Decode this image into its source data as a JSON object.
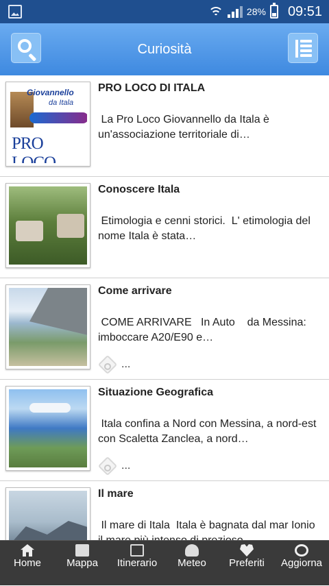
{
  "status_bar": {
    "battery": "28%",
    "time": "09:51"
  },
  "header": {
    "title": "Curiosità",
    "search_icon": "search-icon",
    "menu_icon": "list-menu-icon"
  },
  "items": [
    {
      "title": "PRO LOCO DI ITALA",
      "description": " La Pro Loco Giovannello da Itala è un'associazione territoriale di…",
      "has_more": false,
      "logo": {
        "line1": "Giovannello",
        "line2": "da Itala",
        "line3": "PRO LOCO"
      }
    },
    {
      "title": "Conoscere Itala",
      "description": " Etimologia e cenni storici.  L' etimologia del nome Itala è stata…",
      "has_more": false
    },
    {
      "title": "Come arrivare",
      "description": " COME ARRIVARE   In Auto    da Messina: imboccare A20/E90 e…",
      "has_more": true,
      "more_label": "..."
    },
    {
      "title": "Situazione Geografica",
      "description": " Itala confina a Nord con Messina, a nord-est con Scaletta Zanclea, a nord…",
      "has_more": true,
      "more_label": "..."
    },
    {
      "title": "Il mare",
      "description": " Il mare di Itala  Itala è bagnata dal mar Ionio il mare più intenso di prezioso…",
      "has_more": false
    }
  ],
  "tabbar": [
    {
      "label": "Home",
      "icon": "home-icon"
    },
    {
      "label": "Mappa",
      "icon": "map-icon"
    },
    {
      "label": "Itinerario",
      "icon": "itinerary-icon"
    },
    {
      "label": "Meteo",
      "icon": "weather-icon"
    },
    {
      "label": "Preferiti",
      "icon": "heart-icon"
    },
    {
      "label": "Aggiorna",
      "icon": "refresh-icon"
    }
  ]
}
